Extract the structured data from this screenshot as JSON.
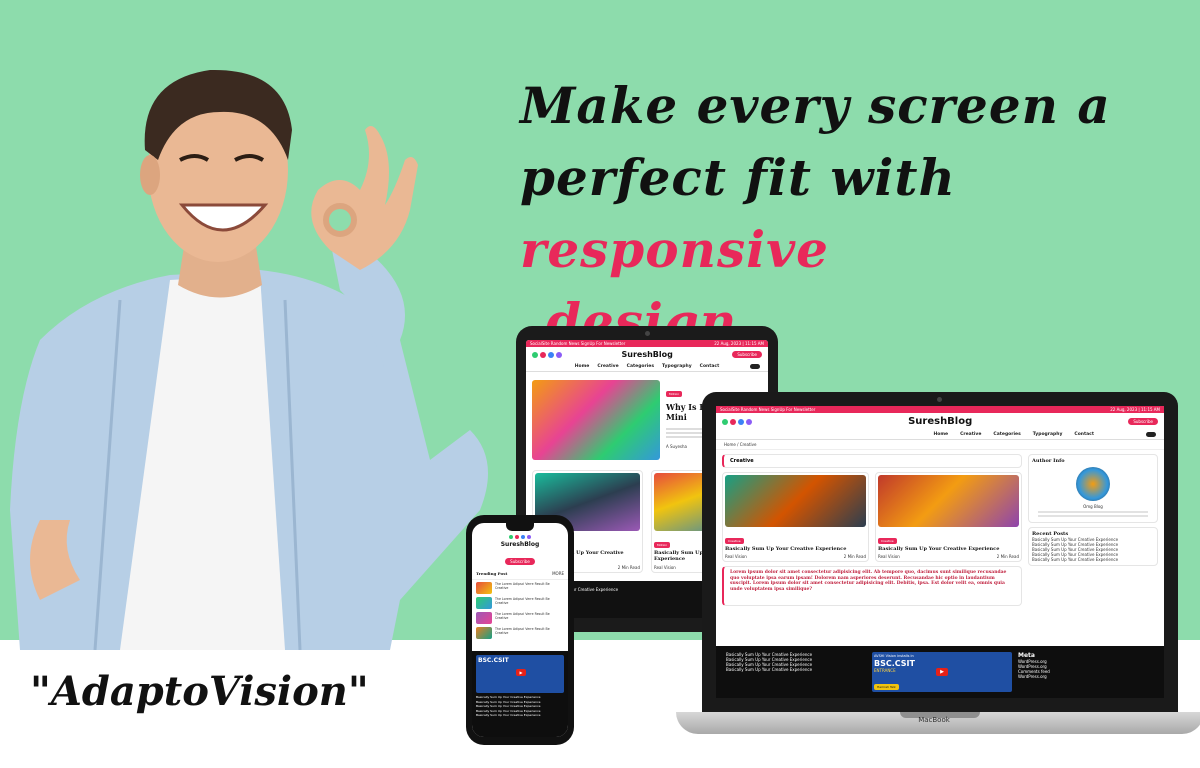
{
  "headline": {
    "part1": "Make every screen a",
    "part2": "perfect fit with ",
    "accent": "responsive",
    "part3": "design."
  },
  "brand": "\"AdaptoVision\"",
  "colors": {
    "background": "#8ddcac",
    "accent": "#e8285a",
    "text": "#111111"
  },
  "laptop": {
    "label": "MacBook",
    "topbar_left": "SocialSite  Random News  SignUp For Newsletter",
    "topbar_right": "22 Aug, 2023 | 11:15 AM",
    "site_title": "SureshBlog",
    "subscribe": "Subscribe",
    "nav": [
      "Home",
      "Creative",
      "Categories",
      "Typography",
      "Contact"
    ],
    "breadcrumb": "Home  /  Creative",
    "section_title": "Creative",
    "posts": [
      {
        "tag": "Creative",
        "title": "Basically Sum Up Your Creative Experience",
        "author": "Real Vision",
        "meta": "2 Min Read"
      },
      {
        "tag": "Creative",
        "title": "Basically Sum Up Your Creative Experience",
        "author": "Real Vision",
        "meta": "2 Min Read"
      }
    ],
    "quote": "Lorem ipsum dolor sit amet consectetur adipisicing elit. Ab tempore quo, dacimus sunt similique recusandae quo voluptate ipsa earum ipsam! Dolorem nam asperiores deserunt. Recusandae hic optio in laudantium suscipit. Lorem ipsum dolor sit amet consectetur adipisicing elit. Debitis, ipsa. Est dolor velit ea, omnis quia unde voluptatem ipsa similique?",
    "author_info_title": "Author Info",
    "author_name": "Omg Blog",
    "recent_posts_title": "Recent Posts",
    "recent_posts": [
      "Basically Sum Up Your Creative Experience",
      "Basically Sum Up Your Creative Experience",
      "Basically Sum Up Your Creative Experience",
      "Basically Sum Up Your Creative Experience",
      "Basically Sum Up Your Creative Experience"
    ],
    "footer_links": [
      "Basically Sum Up Your Creative Experience",
      "Basically Sum Up Your Creative Experience",
      "Basically Sum Up Your Creative Experience",
      "Basically Sum Up Your Creative Experience"
    ],
    "video_title": "AVSHI Vision installs in",
    "video_banner": "BSC.CSIT",
    "video_sub": "ENTRANCE",
    "video_name": "Hamrah Talk",
    "meta_title": "Meta",
    "meta_links": [
      "WordPress.org",
      "WordPress.org",
      "Comments feed",
      "WordPress.org"
    ]
  },
  "tablet": {
    "topbar_left": "SocialSite  Random News  SignUp For Newsletter",
    "topbar_right": "22 Aug, 2023 | 11:15 AM",
    "site_title": "SureshBlog",
    "subscribe": "Subscribe",
    "nav": [
      "Home",
      "Creative",
      "Categories",
      "Typography",
      "Contact"
    ],
    "feature_tag": "Motion",
    "feature_title": "Why Is Every About Mini",
    "feature_author": "A Suyesha",
    "feature_meta": "B 2M-K",
    "cards": [
      {
        "tag": "Motion",
        "title": "Basically Sum Up Your Creative Experience",
        "author": "Real Vision",
        "meta": "2 Min Read"
      },
      {
        "tag": "Motion",
        "title": "Basically Sum Up Your Creative Experience",
        "author": "Real Vision",
        "meta": "2 Min Read"
      }
    ],
    "footer_link": "Basically Sum Up Your Creative Experience"
  },
  "phone": {
    "site_title": "SureshBlog",
    "subscribe": "Subscribe",
    "trending_title": "Trending Post",
    "trending_more": "MORE",
    "items": [
      "The Lorem Adipsci Verre Result Be Creative",
      "The Lorem Adipsci Verre Result Be Creative",
      "The Lorem Adipsci Verre Result Be Creative",
      "The Lorem Adipsci Verre Result Be Creative"
    ],
    "video_banner": "BSC.CSIT",
    "footer_links": [
      "Basically Sum Up Your Creative Experience",
      "Basically Sum Up Your Creative Experience",
      "Basically Sum Up Your Creative Experience",
      "Basically Sum Up Your Creative Experience",
      "Basically Sum Up Your Creative Experience"
    ]
  }
}
